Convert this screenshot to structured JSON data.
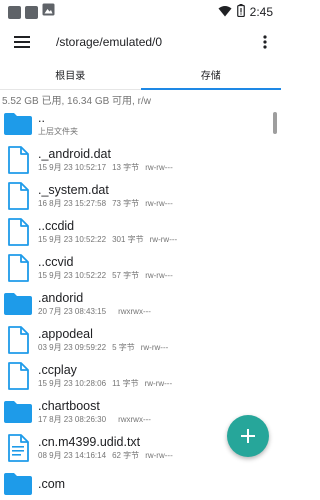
{
  "status_bar": {
    "time": "2:45",
    "icons": [
      "notification-square-icon",
      "notification-square-icon",
      "image-notification-icon",
      "wifi-icon",
      "battery-icon"
    ]
  },
  "toolbar": {
    "path": "/storage/emulated/0",
    "menu_icon": "hamburger-menu-icon",
    "more_icon": "more-vert-icon"
  },
  "tabs": [
    {
      "label": "根目录",
      "active": false
    },
    {
      "label": "存储",
      "active": true
    }
  ],
  "storage_info": "5.52 GB 已用, 16.34 GB 可用, r/w",
  "colors": {
    "folder": "#1e9be9",
    "file": "#1e9be9",
    "accent": "#1e88e5",
    "fab": "#26a69a"
  },
  "files": [
    {
      "name": "..",
      "date": "上层文件夹",
      "size": "",
      "perms": "",
      "type": "folder"
    },
    {
      "name": "._android.dat",
      "date": "15 9月 23 10:52:17",
      "size": "13 字节",
      "perms": "rw-rw---",
      "type": "file"
    },
    {
      "name": "._system.dat",
      "date": "16 8月 23 15:27:58",
      "size": "73 字节",
      "perms": "rw-rw---",
      "type": "file"
    },
    {
      "name": "..ccdid",
      "date": "15 9月 23 10:52:22",
      "size": "301 字节",
      "perms": "rw-rw---",
      "type": "file"
    },
    {
      "name": "..ccvid",
      "date": "15 9月 23 10:52:22",
      "size": "57 字节",
      "perms": "rw-rw---",
      "type": "file"
    },
    {
      "name": ".andorid",
      "date": "20 7月 23 08:43:15",
      "size": "",
      "perms": "rwxrwx---",
      "type": "folder"
    },
    {
      "name": ".appodeal",
      "date": "03 9月 23 09:59:22",
      "size": "5 字节",
      "perms": "rw-rw---",
      "type": "file"
    },
    {
      "name": ".ccplay",
      "date": "15 9月 23 10:28:06",
      "size": "11 字节",
      "perms": "rw-rw---",
      "type": "file"
    },
    {
      "name": ".chartboost",
      "date": "17 8月 23 08:26:30",
      "size": "",
      "perms": "rwxrwx---",
      "type": "folder"
    },
    {
      "name": ".cn.m4399.udid.txt",
      "date": "08 9月 23 14:16:14",
      "size": "62 字节",
      "perms": "rw-rw---",
      "type": "text"
    },
    {
      "name": ".com",
      "date": "",
      "size": "",
      "perms": "",
      "type": "folder"
    }
  ],
  "fab": {
    "icon": "add-icon"
  }
}
